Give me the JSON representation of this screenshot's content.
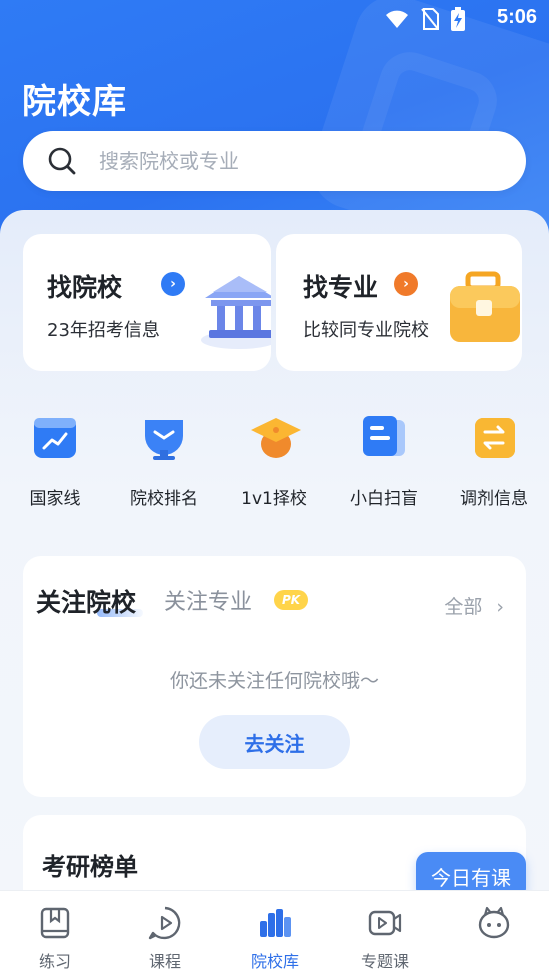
{
  "status_bar": {
    "time": "5:06"
  },
  "header": {
    "title": "院校库"
  },
  "search": {
    "placeholder": "搜索院校或专业"
  },
  "feature_cards": [
    {
      "title": "找院校",
      "subtitle": "23年招考信息",
      "accent": "#2f7bf5"
    },
    {
      "title": "找专业",
      "subtitle": "比较同专业院校",
      "accent": "#f07a2a"
    }
  ],
  "quick_entries": [
    {
      "label": "国家线",
      "icon": "trend-chart-icon"
    },
    {
      "label": "院校排名",
      "icon": "trophy-icon"
    },
    {
      "label": "1v1择校",
      "icon": "graduation-cap-icon"
    },
    {
      "label": "小白扫盲",
      "icon": "document-icon"
    },
    {
      "label": "调剂信息",
      "icon": "swap-icon"
    }
  ],
  "follow": {
    "tab_active": "关注院校",
    "tab_inactive": "关注专业",
    "pk_badge": "PK",
    "all_label": "全部",
    "empty_text": "你还未关注任何院校哦～",
    "button_label": "去关注"
  },
  "ranking": {
    "title": "考研榜单"
  },
  "today_course": {
    "label": "今日有课"
  },
  "tab_bar": [
    {
      "label": "练习",
      "icon": "book-icon",
      "active": false
    },
    {
      "label": "课程",
      "icon": "play-bubble-icon",
      "active": false
    },
    {
      "label": "院校库",
      "icon": "bar-chart-icon",
      "active": true
    },
    {
      "label": "专题课",
      "icon": "video-icon",
      "active": false
    },
    {
      "label": "",
      "icon": "mascot-face-icon",
      "active": false
    }
  ],
  "colors": {
    "brand_blue": "#2f7bf5",
    "active_tab": "#2e6fe8"
  }
}
